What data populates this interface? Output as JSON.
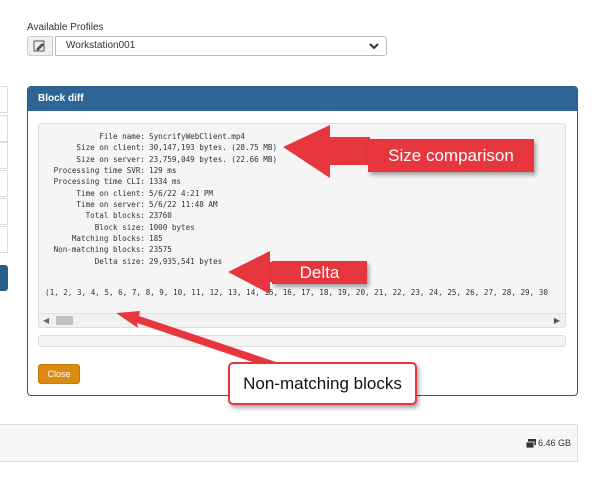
{
  "profiles": {
    "label": "Available Profiles",
    "selected": "Workstation001",
    "icon": "signature-edit-icon"
  },
  "panel": {
    "title": "Block diff",
    "rows": [
      {
        "label": "File name:",
        "value": "SyncrifyWebClient.mp4"
      },
      {
        "label": "Size on client:",
        "value": "30,147,193 bytes. (28.75 MB)"
      },
      {
        "label": "Size on server:",
        "value": "23,759,049 bytes. (22.66 MB)"
      },
      {
        "label": "Processing time SVR:",
        "value": "129 ms"
      },
      {
        "label": "Processing time CLI:",
        "value": "1334 ms"
      },
      {
        "label": "Time on client:",
        "value": "5/6/22 4:21 PM"
      },
      {
        "label": "Time on server:",
        "value": "5/6/22 11:48 AM"
      },
      {
        "label": "Total blocks:",
        "value": "23760"
      },
      {
        "label": "Block size:",
        "value": "1000 bytes"
      },
      {
        "label": "Matching blocks:",
        "value": "185"
      },
      {
        "label": "Non-matching blocks:",
        "value": "23575"
      },
      {
        "label": "Delta size:",
        "value": "29,935,541 bytes"
      }
    ],
    "sequence": "(1, 2, 3, 4, 5, 6, 7, 8, 9, 10, 11, 12, 13, 14, 15, 16, 17, 18, 19, 20, 21, 22, 23, 24, 25, 26, 27, 28, 29, 30",
    "close_label": "Close"
  },
  "footer": {
    "disk_size": "6.46 GB"
  },
  "callouts": {
    "size": "Size comparison",
    "delta": "Delta",
    "nonmatching": "Non-matching blocks"
  },
  "colors": {
    "panel_header": "#2f6596",
    "close_button": "#db8a12",
    "callout_red": "#e8363e"
  }
}
